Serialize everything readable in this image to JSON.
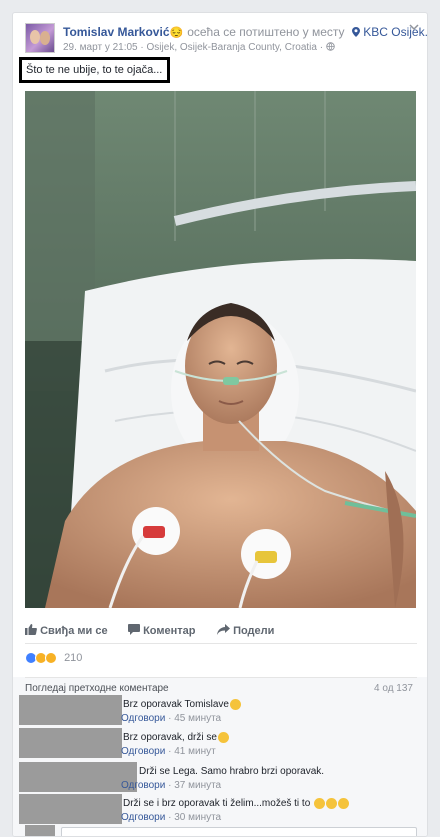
{
  "post": {
    "author": "Tomislav Marković",
    "feeling_emoji": "😔",
    "feeling_text": "осећа се потиштено у месту",
    "place": "KBC Osijek.",
    "date": "29. март у 21:05",
    "separator": "·",
    "location": "Osijek, Osijek-Baranja County, Croatia",
    "privacy_icon": "globe-icon",
    "caption": "Što te ne ubije, to te ojača..."
  },
  "actions": {
    "like": "Свиђа ми се",
    "comment": "Коментар",
    "share": "Подели"
  },
  "reactions": {
    "types": [
      "like",
      "sad",
      "wow"
    ],
    "count": "210"
  },
  "comments_section": {
    "view_previous": "Погледај претходне коментаре",
    "count_label": "4 од 137",
    "reply_label": "Одговори",
    "dot": "·",
    "items": [
      {
        "text": "Brz oporavak Tomislave",
        "emoji_count": 1,
        "time": "45 минута"
      },
      {
        "text": "Brz oporavak, drži se",
        "emoji_count": 1,
        "time": "41 минут"
      },
      {
        "text": "Drži se Lega. Samo hrabro brzi oporavak.",
        "emoji_count": 0,
        "time": "37 минута"
      },
      {
        "text": "Drži se i brz oporavak ti želim...možeš ti to",
        "emoji_count": 3,
        "time": "30 минута"
      }
    ]
  },
  "colors": {
    "link": "#365899",
    "meta": "#90949c",
    "like_blue": "#4080ff",
    "emoji_yellow": "#f5c33b"
  }
}
